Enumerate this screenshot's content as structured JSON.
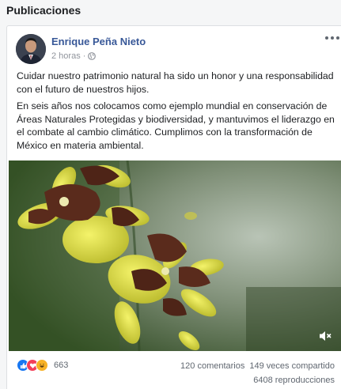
{
  "section": {
    "title": "Publicaciones"
  },
  "post": {
    "author": "Enrique Peña Nieto",
    "time": "2 horas",
    "audience_icon": "globe-icon",
    "paragraphs": [
      "Cuidar nuestro patrimonio natural ha sido un honor y una responsabilidad con el futuro de nuestros hijos.",
      "En seis años nos colocamos como ejemplo mundial en conservación de Áreas Naturales Protegidas y biodiversidad, y mantuvimos el liderazgo en el combate al cambio climático. Cumplimos con la transformación de México en materia ambiental."
    ],
    "media": {
      "type": "video",
      "subject": "orquídeas amarillas con manchas marrones",
      "mute_icon": "speaker-muted-icon"
    }
  },
  "stats": {
    "reactions": [
      "like",
      "love",
      "haha"
    ],
    "reaction_count": "663",
    "comments": "120 comentarios",
    "shares": "149 veces compartido",
    "views": "6408 reproducciones"
  },
  "colors": {
    "link": "#385898",
    "like": "#1877f2",
    "love": "#f33e58",
    "haha": "#f7b125"
  }
}
